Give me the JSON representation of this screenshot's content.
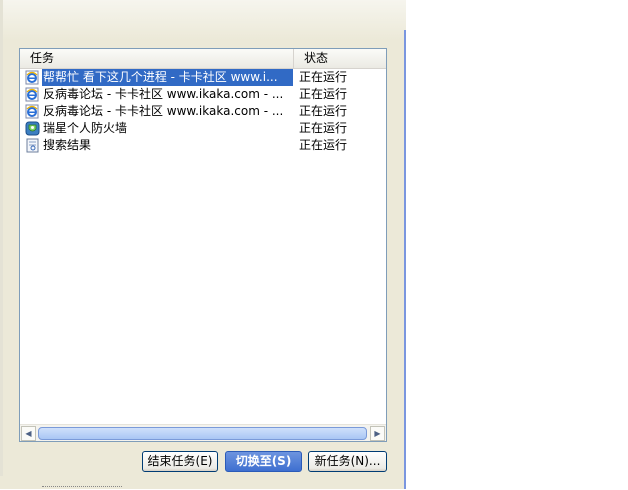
{
  "header": {
    "task_label": "任务",
    "status_label": "状态"
  },
  "tasks": [
    {
      "name": "帮帮忙 看下这几个进程 - 卡卡社区 www.i...",
      "status": "正在运行",
      "icon": "ie-icon",
      "selected": true
    },
    {
      "name": "反病毒论坛 - 卡卡社区 www.ikaka.com - ...",
      "status": "正在运行",
      "icon": "ie-icon",
      "selected": false
    },
    {
      "name": "反病毒论坛 - 卡卡社区 www.ikaka.com - ...",
      "status": "正在运行",
      "icon": "ie-icon",
      "selected": false
    },
    {
      "name": "瑞星个人防火墙",
      "status": "正在运行",
      "icon": "firewall-icon",
      "selected": false
    },
    {
      "name": "搜索结果",
      "status": "正在运行",
      "icon": "search-results-icon",
      "selected": false
    }
  ],
  "buttons": {
    "end_task": "结束任务(E)",
    "switch_to": "切换至(S)",
    "new_task": "新任务(N)..."
  },
  "colors": {
    "selection": "#316ac5",
    "list_border": "#7f9db9",
    "window_bg": "#ece9d8"
  }
}
